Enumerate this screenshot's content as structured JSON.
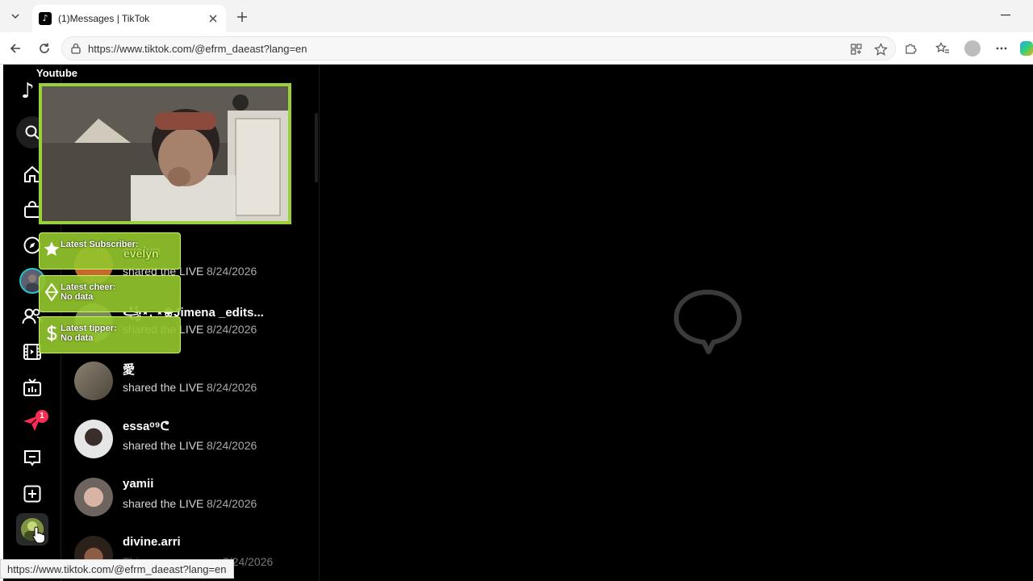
{
  "browser": {
    "tab_title": "(1)Messages | TikTok",
    "url": "https://www.tiktok.com/@efrm_daeast?lang=en",
    "status_url": "https://www.tiktok.com/@efrm_daeast?lang=en"
  },
  "sidebar": {
    "notification_badge": "1"
  },
  "messages": [
    {
      "name": "evelyn",
      "text": "shared the LIVE",
      "date": "8/24/2026",
      "avatar_color": "#c46a2b"
    },
    {
      "name": "꧁⋆. ⋆❀Jimena _edits...",
      "text": "shared the LIVE",
      "date": "8/24/2026",
      "avatar_color": "#7a8a5b"
    },
    {
      "name": "愛",
      "text": "shared the LIVE",
      "date": "8/24/2026",
      "avatar_color": "#6b6658"
    },
    {
      "name": "essaᵒ⁹ᕦ",
      "text": "shared the LIVE",
      "date": "8/24/2026",
      "avatar_color": "#d8d8d8"
    },
    {
      "name": "yamii",
      "text": "shared the LIVE",
      "date": "8/24/2026",
      "avatar_color": "#c9a89a"
    },
    {
      "name": "divine.arri",
      "text": "Thi...",
      "date": "8/24/2026",
      "avatar_color": "#6d4a3a"
    }
  ],
  "overlay": {
    "title": "Youtube",
    "latest_subscriber_label": "Latest Subscriber:",
    "latest_subscriber_value": "evelyn",
    "latest_cheer_label": "Latest cheer:",
    "latest_cheer_value": "No data",
    "latest_tipper_label": "Latest tipper:",
    "latest_tipper_value": "No data",
    "accent_color": "#9ad13a"
  }
}
